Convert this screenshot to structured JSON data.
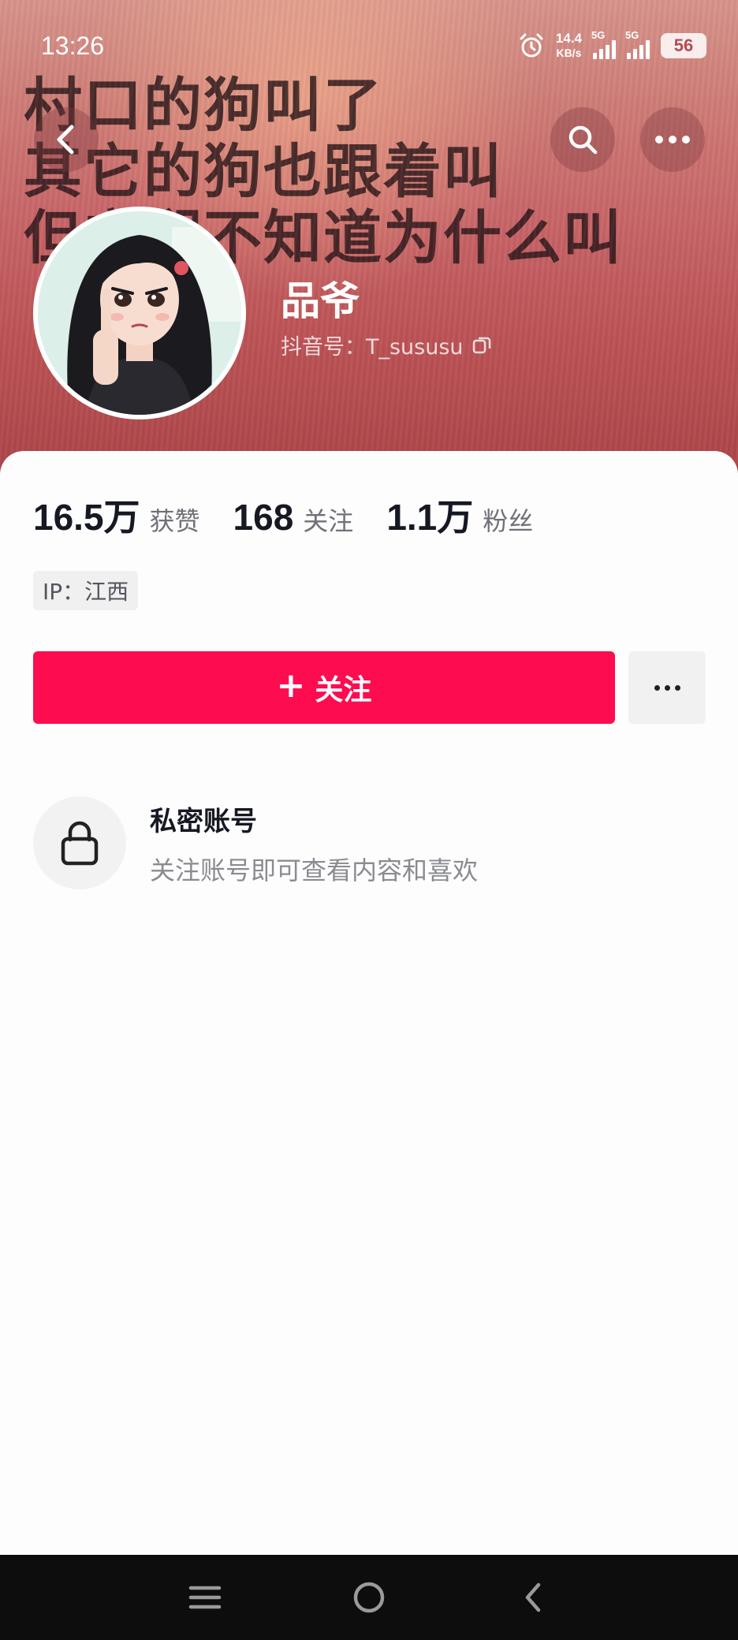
{
  "status_bar": {
    "time": "13:26",
    "net_speed_value": "14.4",
    "net_speed_unit": "KB/s",
    "signal1_label": "5G",
    "signal2_label": "5G",
    "battery": "56"
  },
  "cover": {
    "text_line1": "村口的狗叫了",
    "text_line2": "其它的狗也跟着叫",
    "text_line3": "但它们不知道为什么叫"
  },
  "profile": {
    "nickname": "品爷",
    "douyin_id": "抖音号：T_sususu"
  },
  "stats": [
    {
      "value": "16.5万",
      "label": "获赞"
    },
    {
      "value": "168",
      "label": "关注"
    },
    {
      "value": "1.1万",
      "label": "粉丝"
    }
  ],
  "ip_tag": "IP：江西",
  "follow_button": {
    "plus": "+",
    "label": "关注"
  },
  "private_account": {
    "title": "私密账号",
    "description": "关注账号即可查看内容和喜欢"
  },
  "colors": {
    "accent": "#fe0c50",
    "cover_top": "#d7958c",
    "cover_bottom": "#ad4649",
    "text_primary": "#161823",
    "text_secondary": "#8a8b91"
  },
  "icons": [
    "alarm-icon",
    "back-icon",
    "search-icon",
    "more-icon",
    "copy-icon",
    "lock-icon",
    "menu-icon",
    "home-icon",
    "nav-back-icon"
  ]
}
